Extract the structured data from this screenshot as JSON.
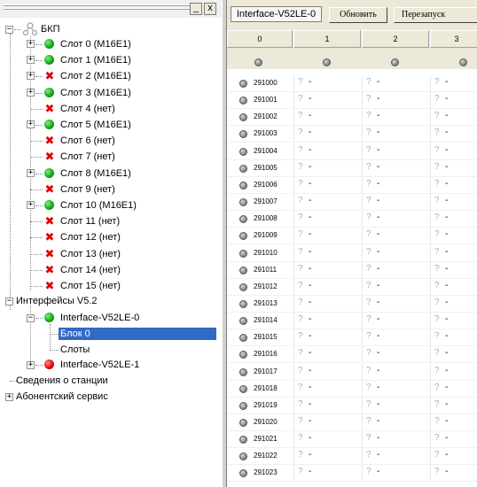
{
  "window": {
    "close_glyph": "x",
    "minimize_glyph": "_"
  },
  "tree": {
    "root": "БКП",
    "slots": [
      {
        "label": "Слот 0 (М16Е1)",
        "status": "green",
        "expandable": true
      },
      {
        "label": "Слот 1 (М16Е1)",
        "status": "green",
        "expandable": true
      },
      {
        "label": "Слот 2 (М16Е1)",
        "status": "error",
        "expandable": true
      },
      {
        "label": "Слот 3 (М16Е1)",
        "status": "green",
        "expandable": true
      },
      {
        "label": "Слот 4 (нет)",
        "status": "error",
        "expandable": false
      },
      {
        "label": "Слот 5 (М16Е1)",
        "status": "green",
        "expandable": true
      },
      {
        "label": "Слот 6 (нет)",
        "status": "error",
        "expandable": false
      },
      {
        "label": "Слот 7 (нет)",
        "status": "error",
        "expandable": false
      },
      {
        "label": "Слот 8 (М16Е1)",
        "status": "green",
        "expandable": true
      },
      {
        "label": "Слот 9 (нет)",
        "status": "error",
        "expandable": false
      },
      {
        "label": "Слот 10 (М16Е1)",
        "status": "green",
        "expandable": true
      },
      {
        "label": "Слот 11 (нет)",
        "status": "error",
        "expandable": false
      },
      {
        "label": "Слот 12 (нет)",
        "status": "error",
        "expandable": false
      },
      {
        "label": "Слот 13 (нет)",
        "status": "error",
        "expandable": false
      },
      {
        "label": "Слот 14 (нет)",
        "status": "error",
        "expandable": false
      },
      {
        "label": "Слот 15 (нет)",
        "status": "error",
        "expandable": false
      }
    ],
    "interfaces": "Интерфейсы V5.2",
    "iface0": "Interface-V52LE-0",
    "block0": "Блок 0",
    "slots_node": "Слоты",
    "iface1": "Interface-V52LE-1",
    "station_info": "Сведения о станции",
    "subscriber": "Абонентский сервис"
  },
  "panel": {
    "title": "Interface-V52LE-0",
    "refresh_button": "Обновить",
    "restart_button": "Перезапуск",
    "columns": [
      "0",
      "1",
      "2",
      "3"
    ],
    "rows": [
      "291000",
      "291001",
      "291002",
      "291003",
      "291004",
      "291005",
      "291006",
      "291007",
      "291008",
      "291009",
      "291010",
      "291011",
      "291012",
      "291013",
      "291014",
      "291015",
      "291016",
      "291017",
      "291018",
      "291019",
      "291020",
      "291021",
      "291022",
      "291023"
    ],
    "cell_question": "?",
    "cell_dash": "-"
  },
  "colors": {
    "green": "#12a012",
    "red": "#e00000",
    "selection": "#316ac5"
  }
}
